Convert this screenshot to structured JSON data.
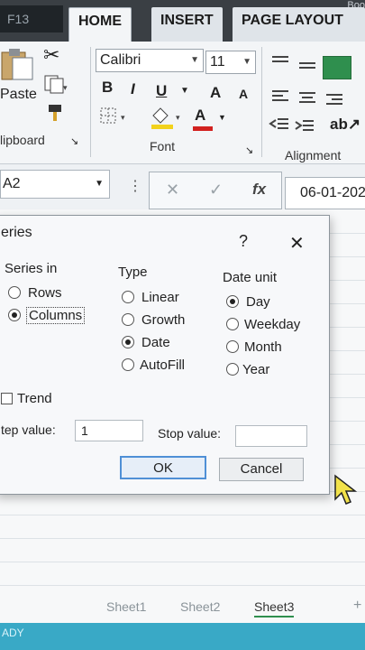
{
  "quick_access": {
    "text": "F13"
  },
  "corner_text": "Boo",
  "tabs": [
    {
      "label": "HOME"
    },
    {
      "label": "INSERT"
    },
    {
      "label": "PAGE LAYOUT"
    }
  ],
  "clipboard": {
    "paste_label": "Paste",
    "group_label": "lipboard"
  },
  "font": {
    "name": "Calibri",
    "size": "11",
    "group_label": "Font",
    "bold": "B",
    "italic": "I",
    "underline": "U",
    "grow": "A",
    "shrink": "A",
    "font_color": "A"
  },
  "alignment": {
    "group_label": "Alignment"
  },
  "formula_bar": {
    "name_box": "A2",
    "value": "06-01-202"
  },
  "dialog": {
    "title": "eries",
    "help": "?",
    "close": "✕",
    "series_in": {
      "label": "Series in",
      "options": [
        "Rows",
        "Columns"
      ],
      "selected": "Columns"
    },
    "type": {
      "label": "Type",
      "options": [
        "Linear",
        "Growth",
        "Date",
        "AutoFill"
      ],
      "selected": "Date"
    },
    "date_unit": {
      "label": "Date unit",
      "options": [
        "Day",
        "Weekday",
        "Month",
        "Year"
      ],
      "selected": "Day"
    },
    "trend_label": "Trend",
    "step_label": "tep value:",
    "step_value": "1",
    "stop_label": "Stop value:",
    "stop_value": "",
    "ok": "OK",
    "cancel": "Cancel"
  },
  "sheets": [
    "Sheet1",
    "Sheet2",
    "Sheet3"
  ],
  "status": "ADY",
  "colors": {
    "accent": "#2f8f4e",
    "status_bar": "#39a9c6",
    "selection": "#4f8fd6"
  }
}
